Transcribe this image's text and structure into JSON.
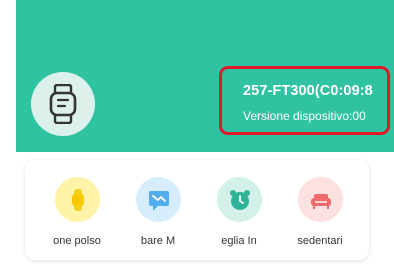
{
  "device": {
    "name": "257-FT300(C0:09:8",
    "version_label": "Versione dispositivo:00"
  },
  "colors": {
    "header": "#2fc3a2",
    "highlight_border": "#e0192b",
    "avatar_bg": "#dcf0ec",
    "wrist_bg": "#fff3a8",
    "message_bg": "#d6eefc",
    "alarm_bg": "#d3f1e9",
    "sedentary_bg": "#fde0e0"
  },
  "features": [
    {
      "label": "one polso",
      "icon": "wrist-band-icon"
    },
    {
      "label": "bare   M",
      "icon": "message-icon"
    },
    {
      "label": "eglia   In",
      "icon": "alarm-clock-icon"
    },
    {
      "label": "sedentari",
      "icon": "sofa-icon"
    }
  ]
}
